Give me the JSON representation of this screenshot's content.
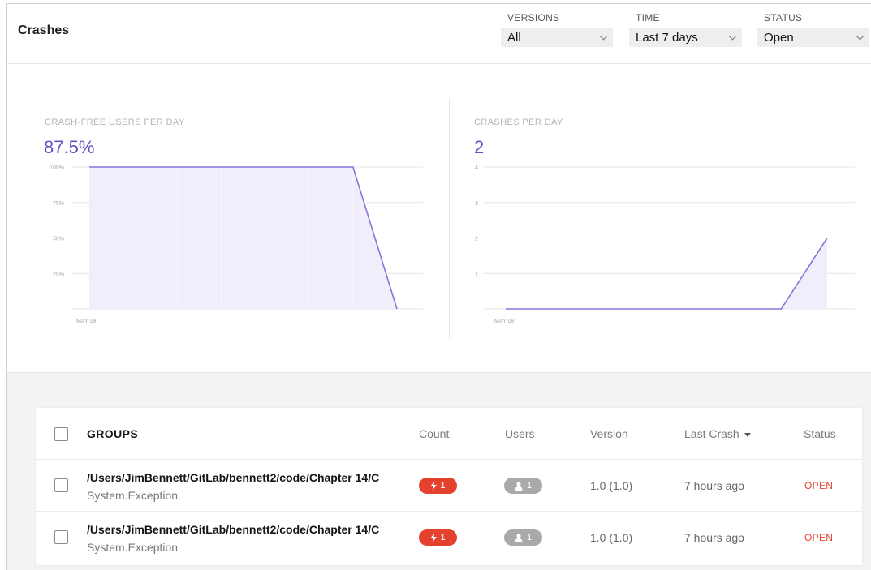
{
  "header": {
    "title": "Crashes",
    "filters": {
      "versions": {
        "label": "VERSIONS",
        "value": "All"
      },
      "time": {
        "label": "TIME",
        "value": "Last 7 days"
      },
      "status": {
        "label": "STATUS",
        "value": "Open"
      }
    }
  },
  "charts": {
    "crash_free": {
      "title": "CRASH-FREE USERS PER DAY",
      "big_value": "87.5%"
    },
    "crashes": {
      "title": "CRASHES PER DAY",
      "big_value": "2"
    }
  },
  "chart_data": [
    {
      "type": "area",
      "title": "CRASH-FREE USERS PER DAY",
      "y_ticks": [
        "100%",
        "75%",
        "50%",
        "25%"
      ],
      "x_tick_labels": [
        "MAY 09"
      ],
      "x": [
        0,
        1,
        2,
        3,
        4,
        5,
        6,
        7
      ],
      "values": [
        100,
        100,
        100,
        100,
        100,
        100,
        100,
        0
      ],
      "ylim": [
        0,
        100
      ],
      "grid": true,
      "color": "#8a72d9"
    },
    {
      "type": "area",
      "title": "CRASHES PER DAY",
      "y_ticks": [
        "4",
        "3",
        "2",
        "1"
      ],
      "x_tick_labels": [
        "MAY 09"
      ],
      "x": [
        0,
        1,
        2,
        3,
        4,
        5,
        6,
        7
      ],
      "values": [
        0,
        0,
        0,
        0,
        0,
        0,
        0,
        2
      ],
      "ylim": [
        0,
        4
      ],
      "grid": true,
      "color": "#8a72d9"
    }
  ],
  "table": {
    "headers": {
      "groups": "GROUPS",
      "count": "Count",
      "users": "Users",
      "version": "Version",
      "last_crash": "Last Crash",
      "status": "Status"
    },
    "rows": [
      {
        "title": "/Users/JimBennett/GitLab/bennett2/code/Chapter 14/C",
        "subtitle": "System.Exception",
        "count": "1",
        "users": "1",
        "version": "1.0 (1.0)",
        "last_crash": "7 hours ago",
        "status": "OPEN"
      },
      {
        "title": "/Users/JimBennett/GitLab/bennett2/code/Chapter 14/C",
        "subtitle": "System.Exception",
        "count": "1",
        "users": "1",
        "version": "1.0 (1.0)",
        "last_crash": "7 hours ago",
        "status": "OPEN"
      }
    ]
  },
  "colors": {
    "accent": "#6b4fc7",
    "chart_line": "#8a72d9",
    "chart_fill": "#f1edfb",
    "open_status": "#e4412e",
    "count_pill": "#e4412e",
    "users_pill": "#a9a9a9"
  },
  "icons": {
    "count": "lightning-icon",
    "users": "user-icon",
    "dropdown": "chevron-down-icon",
    "sort": "sort-desc-icon"
  }
}
